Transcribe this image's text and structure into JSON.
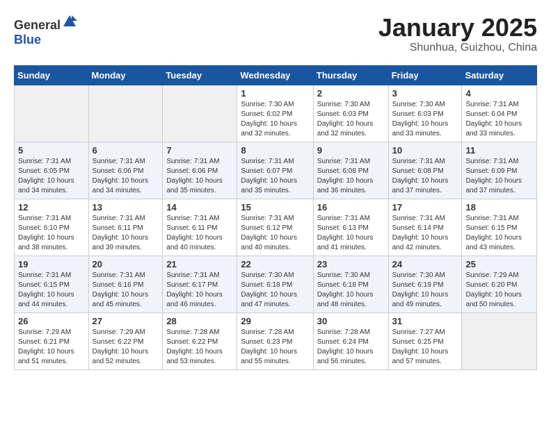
{
  "header": {
    "logo_general": "General",
    "logo_blue": "Blue",
    "month_title": "January 2025",
    "location": "Shunhua, Guizhou, China"
  },
  "weekdays": [
    "Sunday",
    "Monday",
    "Tuesday",
    "Wednesday",
    "Thursday",
    "Friday",
    "Saturday"
  ],
  "weeks": [
    [
      {
        "day": "",
        "info": ""
      },
      {
        "day": "",
        "info": ""
      },
      {
        "day": "",
        "info": ""
      },
      {
        "day": "1",
        "info": "Sunrise: 7:30 AM\nSunset: 6:02 PM\nDaylight: 10 hours\nand 32 minutes."
      },
      {
        "day": "2",
        "info": "Sunrise: 7:30 AM\nSunset: 6:03 PM\nDaylight: 10 hours\nand 32 minutes."
      },
      {
        "day": "3",
        "info": "Sunrise: 7:30 AM\nSunset: 6:03 PM\nDaylight: 10 hours\nand 33 minutes."
      },
      {
        "day": "4",
        "info": "Sunrise: 7:31 AM\nSunset: 6:04 PM\nDaylight: 10 hours\nand 33 minutes."
      }
    ],
    [
      {
        "day": "5",
        "info": "Sunrise: 7:31 AM\nSunset: 6:05 PM\nDaylight: 10 hours\nand 34 minutes."
      },
      {
        "day": "6",
        "info": "Sunrise: 7:31 AM\nSunset: 6:06 PM\nDaylight: 10 hours\nand 34 minutes."
      },
      {
        "day": "7",
        "info": "Sunrise: 7:31 AM\nSunset: 6:06 PM\nDaylight: 10 hours\nand 35 minutes."
      },
      {
        "day": "8",
        "info": "Sunrise: 7:31 AM\nSunset: 6:07 PM\nDaylight: 10 hours\nand 35 minutes."
      },
      {
        "day": "9",
        "info": "Sunrise: 7:31 AM\nSunset: 6:08 PM\nDaylight: 10 hours\nand 36 minutes."
      },
      {
        "day": "10",
        "info": "Sunrise: 7:31 AM\nSunset: 6:08 PM\nDaylight: 10 hours\nand 37 minutes."
      },
      {
        "day": "11",
        "info": "Sunrise: 7:31 AM\nSunset: 6:09 PM\nDaylight: 10 hours\nand 37 minutes."
      }
    ],
    [
      {
        "day": "12",
        "info": "Sunrise: 7:31 AM\nSunset: 6:10 PM\nDaylight: 10 hours\nand 38 minutes."
      },
      {
        "day": "13",
        "info": "Sunrise: 7:31 AM\nSunset: 6:11 PM\nDaylight: 10 hours\nand 39 minutes."
      },
      {
        "day": "14",
        "info": "Sunrise: 7:31 AM\nSunset: 6:11 PM\nDaylight: 10 hours\nand 40 minutes."
      },
      {
        "day": "15",
        "info": "Sunrise: 7:31 AM\nSunset: 6:12 PM\nDaylight: 10 hours\nand 40 minutes."
      },
      {
        "day": "16",
        "info": "Sunrise: 7:31 AM\nSunset: 6:13 PM\nDaylight: 10 hours\nand 41 minutes."
      },
      {
        "day": "17",
        "info": "Sunrise: 7:31 AM\nSunset: 6:14 PM\nDaylight: 10 hours\nand 42 minutes."
      },
      {
        "day": "18",
        "info": "Sunrise: 7:31 AM\nSunset: 6:15 PM\nDaylight: 10 hours\nand 43 minutes."
      }
    ],
    [
      {
        "day": "19",
        "info": "Sunrise: 7:31 AM\nSunset: 6:15 PM\nDaylight: 10 hours\nand 44 minutes."
      },
      {
        "day": "20",
        "info": "Sunrise: 7:31 AM\nSunset: 6:16 PM\nDaylight: 10 hours\nand 45 minutes."
      },
      {
        "day": "21",
        "info": "Sunrise: 7:31 AM\nSunset: 6:17 PM\nDaylight: 10 hours\nand 46 minutes."
      },
      {
        "day": "22",
        "info": "Sunrise: 7:30 AM\nSunset: 6:18 PM\nDaylight: 10 hours\nand 47 minutes."
      },
      {
        "day": "23",
        "info": "Sunrise: 7:30 AM\nSunset: 6:18 PM\nDaylight: 10 hours\nand 48 minutes."
      },
      {
        "day": "24",
        "info": "Sunrise: 7:30 AM\nSunset: 6:19 PM\nDaylight: 10 hours\nand 49 minutes."
      },
      {
        "day": "25",
        "info": "Sunrise: 7:29 AM\nSunset: 6:20 PM\nDaylight: 10 hours\nand 50 minutes."
      }
    ],
    [
      {
        "day": "26",
        "info": "Sunrise: 7:29 AM\nSunset: 6:21 PM\nDaylight: 10 hours\nand 51 minutes."
      },
      {
        "day": "27",
        "info": "Sunrise: 7:29 AM\nSunset: 6:22 PM\nDaylight: 10 hours\nand 52 minutes."
      },
      {
        "day": "28",
        "info": "Sunrise: 7:28 AM\nSunset: 6:22 PM\nDaylight: 10 hours\nand 53 minutes."
      },
      {
        "day": "29",
        "info": "Sunrise: 7:28 AM\nSunset: 6:23 PM\nDaylight: 10 hours\nand 55 minutes."
      },
      {
        "day": "30",
        "info": "Sunrise: 7:28 AM\nSunset: 6:24 PM\nDaylight: 10 hours\nand 56 minutes."
      },
      {
        "day": "31",
        "info": "Sunrise: 7:27 AM\nSunset: 6:25 PM\nDaylight: 10 hours\nand 57 minutes."
      },
      {
        "day": "",
        "info": ""
      }
    ]
  ]
}
